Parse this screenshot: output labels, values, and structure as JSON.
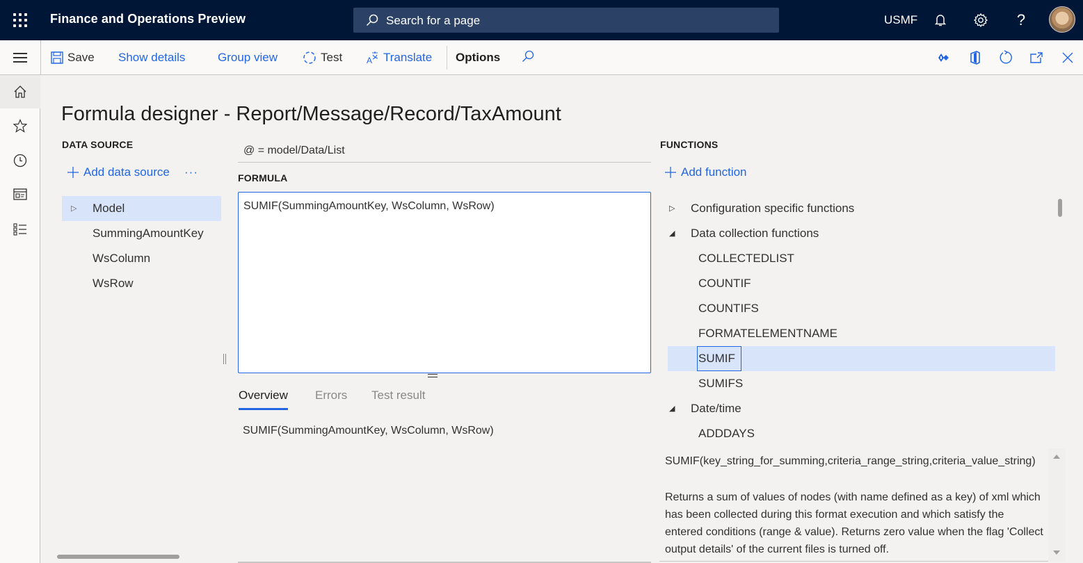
{
  "topbar": {
    "app_title": "Finance and Operations Preview",
    "search_placeholder": "Search for a page",
    "company": "USMF",
    "icons": [
      "waffle-icon",
      "search-icon",
      "bell-icon",
      "gear-icon",
      "help-icon",
      "avatar"
    ]
  },
  "actionbar": {
    "save": "Save",
    "show_details": "Show details",
    "group_view": "Group view",
    "test": "Test",
    "translate": "Translate",
    "options": "Options",
    "right_icons": [
      "power-apps-icon",
      "office-icon",
      "refresh-icon",
      "open-new-window-icon",
      "close-icon"
    ]
  },
  "leftnav": {
    "items": [
      "home",
      "favorites",
      "recent",
      "workspaces",
      "modules"
    ]
  },
  "page": {
    "title": "Formula designer - Report/Message/Record/TaxAmount"
  },
  "datasource": {
    "label": "DATA SOURCE",
    "add_label": "Add data source",
    "more": "···",
    "items": [
      {
        "label": "Model",
        "expandable": true,
        "selected": true
      },
      {
        "label": "SummingAmountKey"
      },
      {
        "label": "WsColumn"
      },
      {
        "label": "WsRow"
      }
    ]
  },
  "formula": {
    "context": "@ = model/Data/List",
    "label": "FORMULA",
    "value": "SUMIF(SummingAmountKey, WsColumn, WsRow)",
    "tabs": [
      {
        "label": "Overview",
        "active": true
      },
      {
        "label": "Errors"
      },
      {
        "label": "Test result"
      }
    ],
    "overview_text": "SUMIF(SummingAmountKey, WsColumn, WsRow)"
  },
  "functions": {
    "label": "FUNCTIONS",
    "add_label": "Add function",
    "items": [
      {
        "label": "Configuration specific functions",
        "type": "group",
        "expanded": false
      },
      {
        "label": "Data collection functions",
        "type": "group",
        "expanded": true
      },
      {
        "label": "COLLECTEDLIST",
        "type": "leaf"
      },
      {
        "label": "COUNTIF",
        "type": "leaf"
      },
      {
        "label": "COUNTIFS",
        "type": "leaf"
      },
      {
        "label": "FORMATELEMENTNAME",
        "type": "leaf"
      },
      {
        "label": "SUMIF",
        "type": "leaf",
        "selected": true
      },
      {
        "label": "SUMIFS",
        "type": "leaf"
      },
      {
        "label": "Date/time",
        "type": "group",
        "expanded": true
      },
      {
        "label": "ADDDAYS",
        "type": "leaf"
      }
    ],
    "description": {
      "signature": "SUMIF(key_string_for_summing,criteria_range_string,criteria_value_string)",
      "body": "Returns a sum of values of nodes (with name defined as a key) of xml which has been collected during this format execution and which satisfy the entered conditions (range & value). Returns zero value when the flag 'Collect output details' of the current files is turned off."
    }
  },
  "colors": {
    "topbar": "#001637",
    "accent": "#2266e3",
    "selection": "#d8e4fa",
    "background": "#f3f2f1"
  }
}
